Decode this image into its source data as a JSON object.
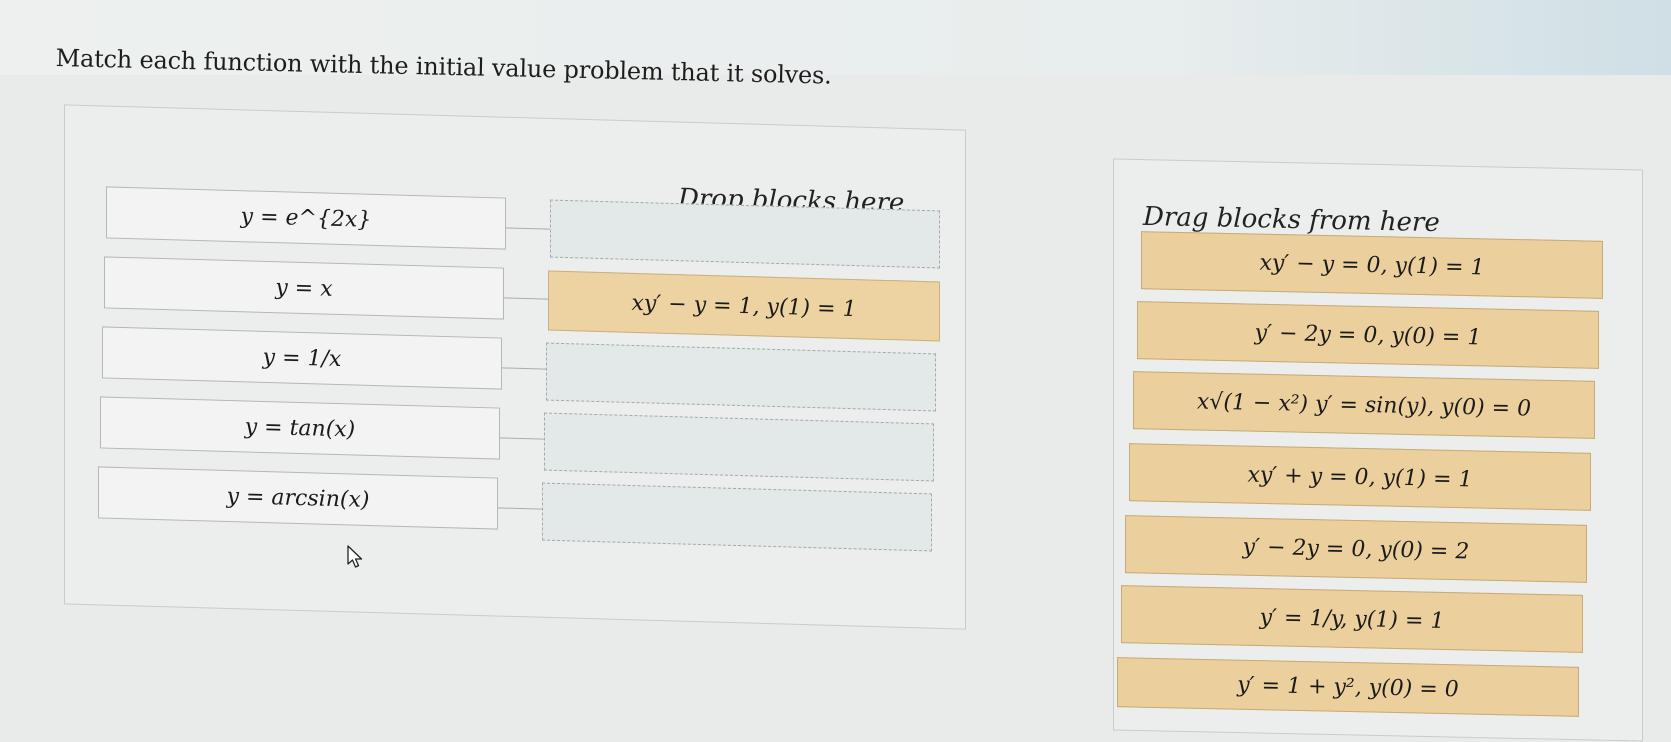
{
  "instruction": "Match each function with the initial value problem that it solves.",
  "drop_header": "Drop blocks here",
  "drag_header": "Drag blocks from here",
  "functions": [
    {
      "label": "y = e^{2x}"
    },
    {
      "label": "y = x"
    },
    {
      "label": "y = 1/x"
    },
    {
      "label": "y = tan(x)"
    },
    {
      "label": "y = arcsin(x)"
    }
  ],
  "drop_zones": [
    {
      "filled": false,
      "label": ""
    },
    {
      "filled": true,
      "label": "xy′ − y = 1, y(1) = 1"
    },
    {
      "filled": false,
      "label": ""
    },
    {
      "filled": false,
      "label": ""
    },
    {
      "filled": false,
      "label": ""
    }
  ],
  "drag_blocks": [
    {
      "label": "xy′ − y = 0, y(1) = 1"
    },
    {
      "label": "y′ − 2y = 0, y(0) = 1"
    },
    {
      "label": "x√(1 − x²) y′ = sin(y), y(0) = 0"
    },
    {
      "label": "xy′ + y = 0, y(1) = 1"
    },
    {
      "label": "y′ − 2y = 0, y(0) = 2"
    },
    {
      "label": "y′ = 1/y, y(1) = 1"
    },
    {
      "label": "y′ = 1 + y², y(0) = 0"
    }
  ],
  "colors": {
    "block": "#ebcf9c",
    "drop_zone": "#e3e8e8",
    "function_box": "#f2f3f2"
  }
}
